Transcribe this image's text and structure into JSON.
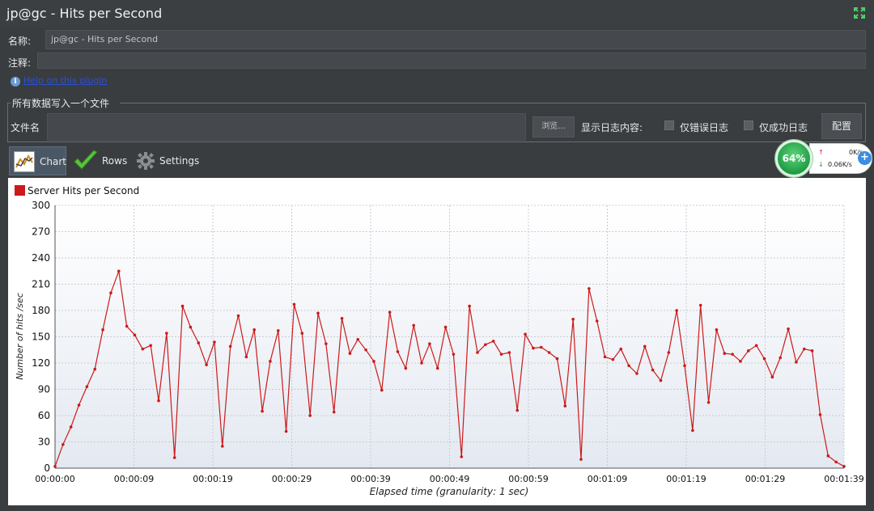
{
  "window": {
    "title": "jp@gc - Hits per Second",
    "expand_icon": "expand-arrows-icon"
  },
  "form": {
    "name_label": "名称:",
    "name_value": "jp@gc - Hits per Second",
    "comment_label": "注释:",
    "comment_value": "",
    "help_link": "Help on this plugin"
  },
  "file_section": {
    "title": "所有数据写入一个文件",
    "filename_label": "文件名",
    "filename_value": "",
    "browse_label": "浏览...",
    "log_content_label": "显示日志内容:",
    "errors_only_label": "仅错误日志",
    "success_only_label": "仅成功日志",
    "configure_label": "配置"
  },
  "tabs": [
    {
      "label": "Chart",
      "icon": "chart-line-icon",
      "active": true
    },
    {
      "label": "Rows",
      "icon": "checkmark-icon",
      "active": false
    },
    {
      "label": "Settings",
      "icon": "gear-icon",
      "active": false
    }
  ],
  "net_widget": {
    "percent": "64%",
    "upload": "0K/s",
    "download": "0.06K/s",
    "plus_icon": "plus-icon"
  },
  "chart_data": {
    "type": "line",
    "title": "",
    "legend": [
      "Server Hits per Second"
    ],
    "legend_placement": "top-left",
    "xlabel": "Elapsed time (granularity: 1 sec)",
    "ylabel": "Number of hits /sec",
    "ylim": [
      0,
      300
    ],
    "yticks": [
      0,
      30,
      60,
      90,
      120,
      150,
      180,
      210,
      240,
      270,
      300
    ],
    "xlim": [
      0,
      99
    ],
    "xtick_labels": [
      "00:00:00",
      "00:00:09",
      "00:00:19",
      "00:00:29",
      "00:00:39",
      "00:00:49",
      "00:00:59",
      "00:01:09",
      "00:01:19",
      "00:01:29",
      "00:01:39"
    ],
    "xtick_positions_seconds": [
      0,
      10,
      20,
      30,
      40,
      50,
      60,
      70,
      80,
      90,
      100
    ],
    "grid": true,
    "series": [
      {
        "name": "Server Hits per Second",
        "color": "#cc1a1a",
        "x": [
          0,
          1,
          2,
          3,
          4,
          5,
          6,
          7,
          8,
          9,
          10,
          11,
          12,
          13,
          14,
          15,
          16,
          17,
          18,
          19,
          20,
          21,
          22,
          23,
          24,
          25,
          26,
          27,
          28,
          29,
          30,
          31,
          32,
          33,
          34,
          35,
          36,
          37,
          38,
          39,
          40,
          41,
          42,
          43,
          44,
          45,
          46,
          47,
          48,
          49,
          50,
          51,
          52,
          53,
          54,
          55,
          56,
          57,
          58,
          59,
          60,
          61,
          62,
          63,
          64,
          65,
          66,
          67,
          68,
          69,
          70,
          71,
          72,
          73,
          74,
          75,
          76,
          77,
          78,
          79,
          80,
          81,
          82,
          83,
          84,
          85,
          86,
          87,
          88,
          89,
          90,
          91,
          92,
          93,
          94,
          95,
          96,
          97,
          98,
          99
        ],
        "values": [
          2,
          27,
          47,
          72,
          93,
          113,
          158,
          200,
          225,
          162,
          152,
          136,
          140,
          77,
          154,
          12,
          185,
          161,
          143,
          118,
          144,
          25,
          139,
          174,
          127,
          158,
          65,
          122,
          157,
          42,
          187,
          154,
          60,
          177,
          142,
          64,
          171,
          131,
          147,
          135,
          122,
          89,
          178,
          133,
          114,
          163,
          120,
          142,
          114,
          161,
          130,
          13,
          185,
          132,
          141,
          145,
          130,
          132,
          66,
          153,
          137,
          138,
          132,
          125,
          71,
          170,
          10,
          205,
          168,
          127,
          124,
          136,
          117,
          108,
          139,
          112,
          100,
          132,
          180,
          117,
          43,
          186,
          75,
          158,
          131,
          130,
          122,
          134,
          140,
          125,
          104,
          126,
          159,
          121,
          136,
          134,
          61,
          14,
          7,
          2
        ]
      }
    ]
  }
}
